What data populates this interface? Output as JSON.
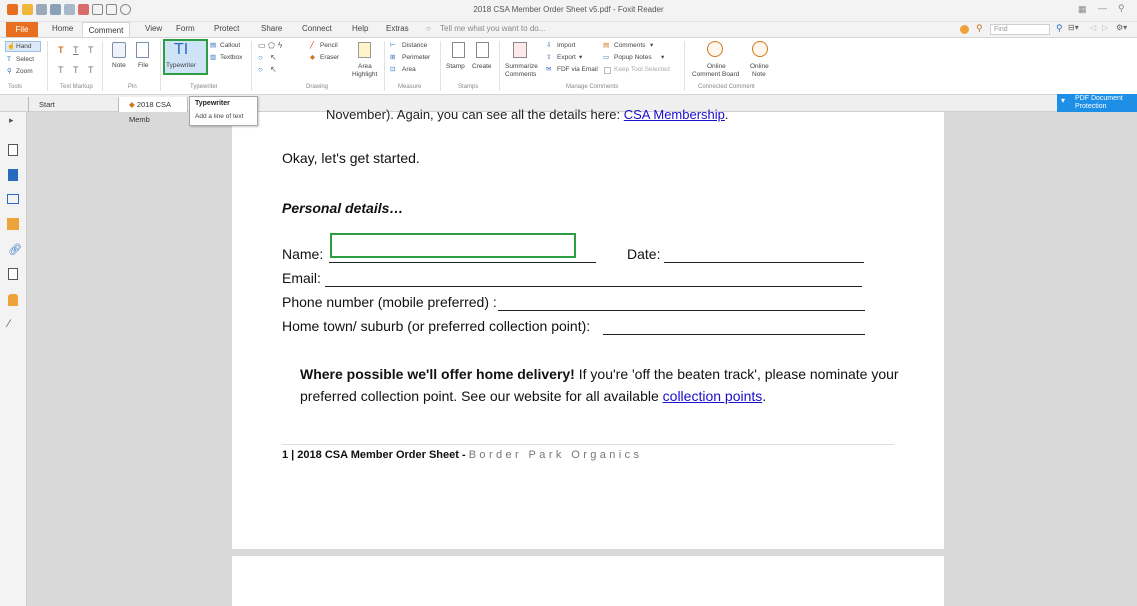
{
  "window": {
    "title": "2018 CSA Member Order Sheet v5.pdf - Foxit Reader",
    "search_placeholder": "Find"
  },
  "menu": {
    "file": "File",
    "items": [
      "Home",
      "Comment",
      "View",
      "Form",
      "Protect",
      "Share",
      "Connect",
      "Help",
      "Extras"
    ],
    "tell_me": "Tell me what you want to do..."
  },
  "ribbon": {
    "tools": {
      "hand": "Hand",
      "select": "Select",
      "zoom": "Zoom",
      "group": "Tools"
    },
    "text_markup": {
      "group": "Text Markup"
    },
    "pin": {
      "note": "Note",
      "file": "File",
      "group": "Pin"
    },
    "typewriter": {
      "typewriter": "Typewriter",
      "callout": "Callout",
      "textbox": "Textbox",
      "group": "Typewriter"
    },
    "drawing": {
      "pencil": "Pencil",
      "eraser": "Eraser",
      "area_highlight_1": "Area",
      "area_highlight_2": "Highlight",
      "group": "Drawing"
    },
    "measure": {
      "distance": "Distance",
      "perimeter": "Perimeter",
      "area": "Area",
      "group": "Measure"
    },
    "stamps": {
      "stamp": "Stamp",
      "create": "Create",
      "group": "Stamps"
    },
    "manage": {
      "summarize_1": "Summarize",
      "summarize_2": "Comments",
      "import": "Import",
      "export": "Export",
      "fdf": "FDF via Email",
      "comments": "Comments",
      "popup": "Popup Notes",
      "keep": "Keep Tool Selected",
      "group": "Manage Comments"
    },
    "connected": {
      "online_board_1": "Online",
      "online_board_2": "Comment Board",
      "online_note_1": "Online",
      "online_note_2": "Note",
      "group": "Connected Comment"
    }
  },
  "tabs": {
    "start": "Start",
    "doc": "2018 CSA Memb",
    "pdf_protection_1": "PDF Document",
    "pdf_protection_2": "Protection"
  },
  "tooltip": {
    "title": "Typewriter",
    "desc": "Add a line of text"
  },
  "document": {
    "cut_line": "November). Again, you can see all the details here:",
    "cut_link": "CSA Membership",
    "intro": "Okay, let's get started.",
    "heading": "Personal details…",
    "name_label": "Name:",
    "date_label": "Date:",
    "email_label": "Email:",
    "phone_label": "Phone number (mobile preferred) :",
    "home_label": "Home town/ suburb (or preferred collection point):",
    "delivery_bold": "Where possible we'll offer home delivery!",
    "delivery_rest": " If you're 'off the beaten track', please nominate your",
    "delivery_line2": "preferred collection point. See our website for all available ",
    "delivery_link": "collection points",
    "delivery_end": ".",
    "footer_bold": "1 | 2018 CSA Member Order Sheet - ",
    "footer_light": "Border Park Organics"
  },
  "colors": {
    "accent_orange": "#e86f1f",
    "highlight_green": "#2e9e45",
    "link_blue": "#1a0dcc",
    "protection_blue": "#1e8fe6"
  }
}
